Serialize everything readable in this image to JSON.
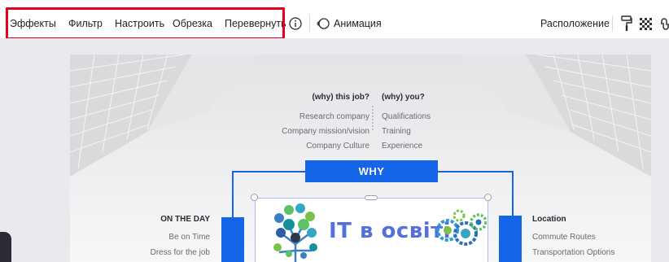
{
  "toolbar": {
    "items": [
      {
        "label": "Эффекты"
      },
      {
        "label": "Фильтр"
      },
      {
        "label": "Настроить"
      },
      {
        "label": "Обрезка"
      },
      {
        "label": "Перевернуть"
      }
    ],
    "animation_label": "Анимация",
    "position_label": "Расположение",
    "icons": [
      "info-icon",
      "animation-icon",
      "paint-roller-icon",
      "transparency-icon",
      "link-icon"
    ],
    "highlight_color": "#e3001b"
  },
  "slide": {
    "headings": {
      "why_this_job": "(why) this job?",
      "why_you": "(why) you?",
      "on_the_day": "ON THE DAY",
      "location": "Location"
    },
    "left_column": [
      "Research company",
      "Company mission/vision",
      "Company Culture"
    ],
    "right_column": [
      "Qualifications",
      "Training",
      "Experience"
    ],
    "on_the_day_items": [
      "Be on Time",
      "Dress for the job"
    ],
    "location_items": [
      "Commute Routes",
      "Transportation Options"
    ],
    "why_label": "WHY",
    "image_title": "IT в освіті",
    "accent_color": "#1565e8"
  }
}
